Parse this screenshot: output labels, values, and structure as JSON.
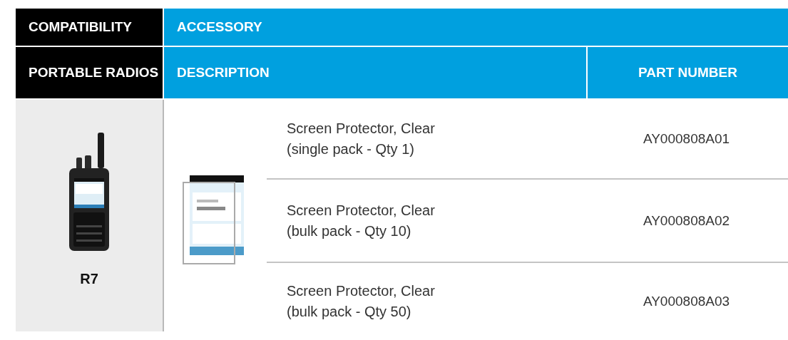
{
  "header": {
    "compatibility": "COMPATIBILITY",
    "accessory": "ACCESSORY",
    "category": "PORTABLE RADIOS",
    "description": "DESCRIPTION",
    "part_number": "PART NUMBER"
  },
  "radio": {
    "name": "R7"
  },
  "items": [
    {
      "name": "Screen Protector, Clear",
      "pack": "(single pack - Qty 1)",
      "part_number": "AY000808A01"
    },
    {
      "name": "Screen Protector, Clear",
      "pack": "(bulk pack - Qty 10)",
      "part_number": "AY000808A02"
    },
    {
      "name": "Screen Protector, Clear",
      "pack": "(bulk pack - Qty 50)",
      "part_number": "AY000808A03"
    }
  ]
}
